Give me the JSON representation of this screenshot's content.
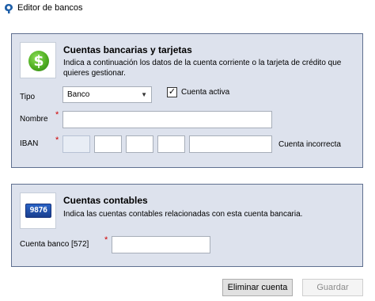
{
  "window": {
    "title": "Editor de bancos",
    "app_icon": "app-logo-icon"
  },
  "bank_panel": {
    "icon": "dollar-icon",
    "title": "Cuentas bancarias y tarjetas",
    "description": "Indica a continuación los datos de la cuenta corriente o la tarjeta de crédito que quieres gestionar.",
    "tipo_label": "Tipo",
    "tipo_value": "Banco",
    "active_checkbox": {
      "label": "Cuenta activa",
      "checked": true,
      "check_mark": "✓"
    },
    "nombre_label": "Nombre",
    "nombre_value": "",
    "iban_label": "IBAN",
    "iban_parts": [
      "",
      "",
      "",
      "",
      ""
    ],
    "iban_status": "Cuenta incorrecta",
    "required_mark": "*"
  },
  "accounting_panel": {
    "icon": "calculator-icon",
    "icon_display": "9876",
    "title": "Cuentas contables",
    "description": "Indica las cuentas contables relacionadas con esta cuenta bancaria.",
    "cuenta_banco_label": "Cuenta banco [572]",
    "cuenta_banco_value": "",
    "required_mark": "*"
  },
  "buttons": {
    "delete_label": "Eliminar cuenta",
    "save_label": "Guardar"
  },
  "colors": {
    "panel_background": "#dde2ed",
    "panel_border": "#5f6f8f",
    "required_star": "#d00000",
    "disabled_text": "#8c8c8c"
  }
}
